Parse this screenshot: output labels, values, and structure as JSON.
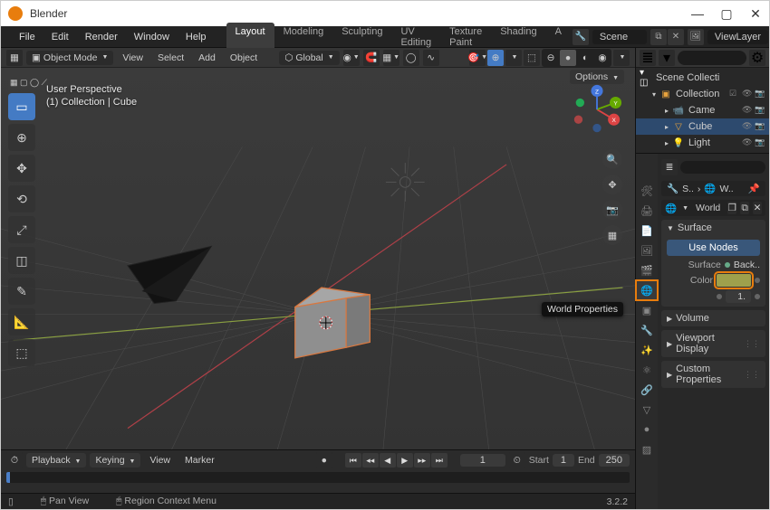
{
  "title": "Blender",
  "menus": {
    "file": "File",
    "edit": "Edit",
    "render": "Render",
    "window": "Window",
    "help": "Help"
  },
  "workspaces": {
    "layout": "Layout",
    "modeling": "Modeling",
    "sculpting": "Sculpting",
    "uv_editing": "UV Editing",
    "texture_paint": "Texture Paint",
    "shading": "Shading",
    "more": "A"
  },
  "scene": {
    "label": "Scene",
    "viewlayer": "ViewLayer"
  },
  "header": {
    "mode": "Object Mode",
    "view": "View",
    "select": "Select",
    "add": "Add",
    "object": "Object",
    "orientation": "Global",
    "options": "Options"
  },
  "viewport": {
    "line1": "User Perspective",
    "line2": "(1) Collection | Cube"
  },
  "timeline": {
    "playback": "Playback",
    "keying": "Keying",
    "view": "View",
    "marker": "Marker",
    "frame": "1",
    "start_label": "Start",
    "start": "1",
    "end_label": "End",
    "end": "250"
  },
  "statusbar": {
    "hint1": "Pan View",
    "hint2": "Region Context Menu",
    "version": "3.2.2"
  },
  "outliner": {
    "root": "Scene Collecti",
    "collection": "Collection",
    "items": [
      "Came",
      "Cube",
      "Light"
    ]
  },
  "properties": {
    "tooltip": "World Properties",
    "breadcrumb": {
      "s": "S..",
      "w": "W.."
    },
    "world_label": "World",
    "surface_label": "Surface",
    "use_nodes": "Use Nodes",
    "surface_prop": "Surface",
    "surface_val": "Back..",
    "color_label": "Color",
    "strength_val": "1.",
    "volume_label": "Volume",
    "viewport_display": "Viewport Display",
    "custom_props": "Custom Properties"
  }
}
